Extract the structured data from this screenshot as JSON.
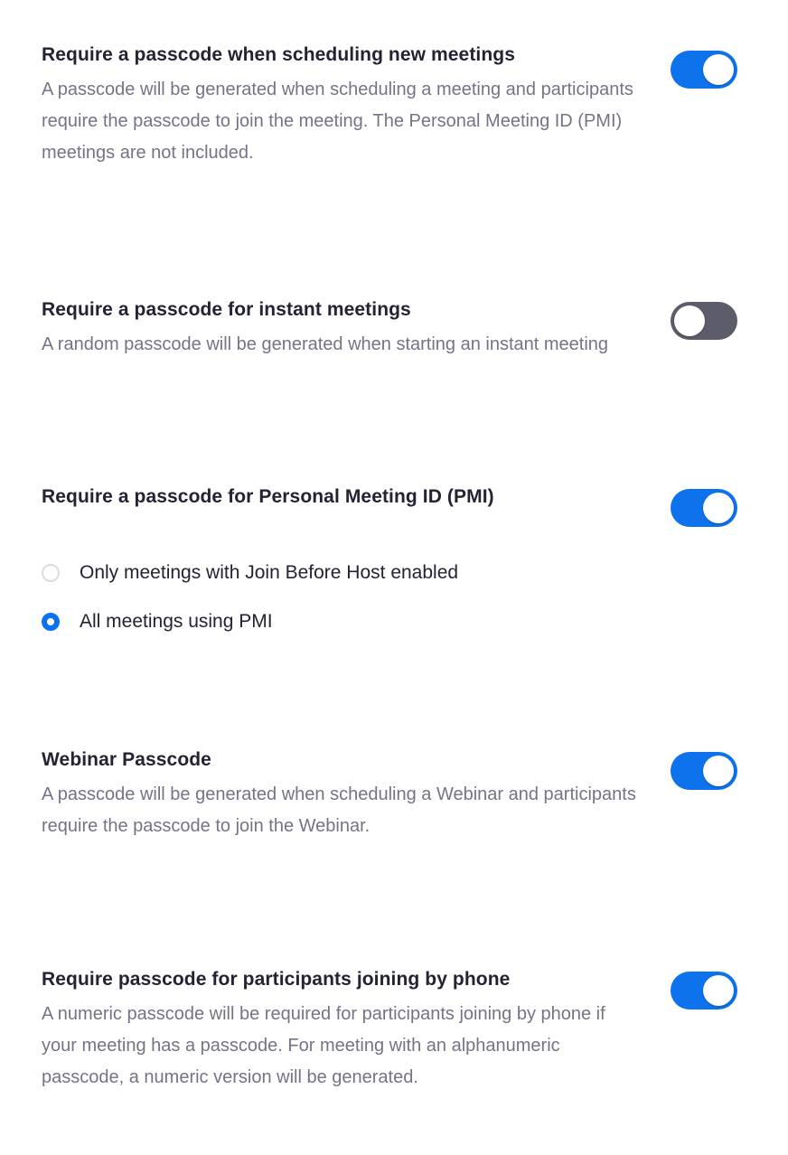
{
  "settings": {
    "scheduling": {
      "title": "Require a passcode when scheduling new meetings",
      "description": "A passcode will be generated when scheduling a meeting and participants require the passcode to join the meeting. The Personal Meeting ID (PMI) meetings are not included.",
      "enabled": true
    },
    "instant": {
      "title": "Require a passcode for instant meetings",
      "description": "A random passcode will be generated when starting an instant meeting",
      "enabled": false
    },
    "pmi": {
      "title": "Require a passcode for Personal Meeting ID (PMI)",
      "enabled": true,
      "options": [
        {
          "label": "Only meetings with Join Before Host enabled",
          "selected": false
        },
        {
          "label": "All meetings using PMI",
          "selected": true
        }
      ]
    },
    "webinar": {
      "title": "Webinar Passcode",
      "description": "A passcode will be generated when scheduling a Webinar and participants require the passcode to join the Webinar.",
      "enabled": true
    },
    "phone": {
      "title": "Require passcode for participants joining by phone",
      "description": "A numeric passcode will be required for participants joining by phone if your meeting has a passcode. For meeting with an alphanumeric passcode, a numeric version will be generated.",
      "enabled": true
    }
  },
  "colors": {
    "accent": "#0e72ed",
    "toggle_off": "#5c5c6b",
    "title": "#232333",
    "description": "#747487"
  }
}
